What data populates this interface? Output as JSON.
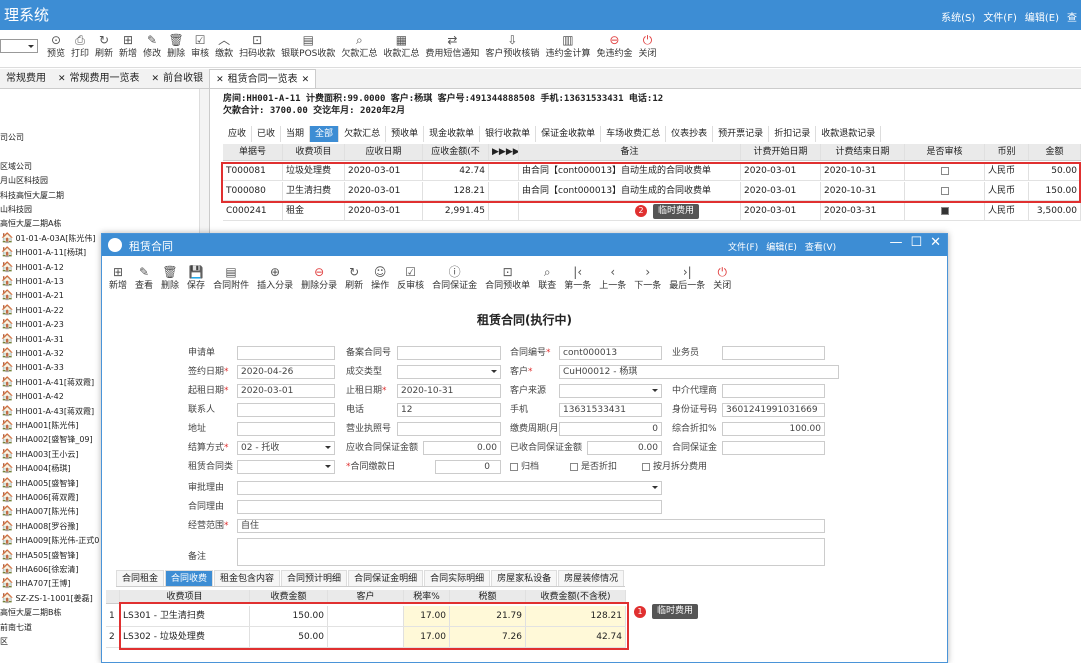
{
  "app": {
    "title": "理系统",
    "menu": [
      "系统(S)",
      "文件(F)",
      "编辑(E)",
      "查"
    ]
  },
  "toolbar": {
    "items": [
      {
        "icon": "preview-icon",
        "glyph": "⊙",
        "label": "预览"
      },
      {
        "icon": "print-icon",
        "glyph": "⎙",
        "label": "打印"
      },
      {
        "icon": "refresh-icon",
        "glyph": "↻",
        "label": "刷新"
      },
      {
        "icon": "add-icon",
        "glyph": "⊞",
        "label": "新增"
      },
      {
        "icon": "edit-icon",
        "glyph": "✎",
        "label": "修改"
      },
      {
        "icon": "delete-icon",
        "glyph": "🗑",
        "label": "删除"
      },
      {
        "icon": "audit-icon",
        "glyph": "☑",
        "label": "审核"
      },
      {
        "icon": "pay-icon",
        "glyph": "︿",
        "label": "缴款"
      },
      {
        "icon": "scan-pay-icon",
        "glyph": "⊡",
        "label": "扫码收款"
      },
      {
        "icon": "pos-icon",
        "glyph": "▤",
        "label": "银联POS收款"
      },
      {
        "icon": "arrears-icon",
        "glyph": "⌕",
        "label": "欠款汇总"
      },
      {
        "icon": "receipt-summary-icon",
        "glyph": "▦",
        "label": "收款汇总"
      },
      {
        "icon": "sms-icon",
        "glyph": "⇄",
        "label": "费用短信通知"
      },
      {
        "icon": "prepay-icon",
        "glyph": "⇩",
        "label": "客户预收核销"
      },
      {
        "icon": "penalty-icon",
        "glyph": "▥",
        "label": "违约金计算"
      },
      {
        "icon": "waive-icon",
        "glyph": "⊖",
        "label": "免违约金"
      },
      {
        "icon": "close-icon",
        "glyph": "⏻",
        "label": "关闭"
      }
    ]
  },
  "tabs": [
    {
      "label": "常规费用"
    },
    {
      "label": "常规费用一览表"
    },
    {
      "label": "前台收银"
    },
    {
      "label": "租赁合同一览表"
    }
  ],
  "tree": {
    "items": [
      "司公司",
      "",
      "区域公司",
      "月山区科技园",
      "科技高恒大厦二期",
      "山科技园",
      "高恒大厦二期A栋",
      "01-01-A-03A[陈光伟]",
      "HH001-A-11[杨琪]",
      "HH001-A-12",
      "HH001-A-13",
      "HH001-A-21",
      "HH001-A-22",
      "HH001-A-23",
      "HH001-A-31",
      "HH001-A-32",
      "HH001-A-33",
      "HH001-A-41[蒋双霞]",
      "HH001-A-42",
      "HH001-A-43[蒋双霞]",
      "HHA001[陈光伟]",
      "HHA002[盛智锋_09]",
      "HHA003[王小云]",
      "HHA004[杨琪]",
      "HHA005[盛智锋]",
      "HHA006[蒋双霞]",
      "HHA007[陈光伟]",
      "HHA008[罗谷豫]",
      "HHA009[陈光伟-正式0",
      "HHA505[盛智锋]",
      "HHA606[徐宏清]",
      "HHA707[王博]",
      "SZ-ZS-1-1001[姜磊]",
      "高恒大厦二期B栋",
      "前南七道",
      "区"
    ]
  },
  "info": {
    "line1": "房间:HH001-A-11  计费面积:99.0000 客户:杨琪 客户号:491344888508 手机:13631533431 电话:12",
    "line2": "欠款合计: 3700.00  交讫年月: 2020年2月"
  },
  "subtabs": [
    "应收",
    "已收",
    "当期",
    "全部",
    "欠款汇总",
    "预收单",
    "现金收款单",
    "银行收款单",
    "保证金收款单",
    "车场收费汇总",
    "仪表抄表",
    "预开票记录",
    "折扣记录",
    "收款退款记录"
  ],
  "grid": {
    "headers": [
      "单据号",
      "收费项目",
      "应收日期",
      "应收金额(不",
      "▶▶▶▶",
      "备注",
      "计费开始日期",
      "计费结束日期",
      "是否审核",
      "币别",
      "金额"
    ],
    "rows": [
      {
        "no": "T000081",
        "item": "垃圾处理费",
        "date": "2020-03-01",
        "amount": "42.74",
        "remark": "由合同【cont000013】自动生成的合同收费单",
        "start": "2020-03-01",
        "end": "2020-10-31",
        "currency": "人民币",
        "money": "50.00"
      },
      {
        "no": "T000080",
        "item": "卫生清扫费",
        "date": "2020-03-01",
        "amount": "128.21",
        "remark": "由合同【cont000013】自动生成的合同收费单",
        "start": "2020-03-01",
        "end": "2020-10-31",
        "currency": "人民币",
        "money": "150.00"
      },
      {
        "no": "C000241",
        "item": "租金",
        "date": "2020-03-01",
        "amount": "2,991.45",
        "remark": "",
        "start": "2020-03-01",
        "end": "2020-03-31",
        "currency": "人民币",
        "money": "3,500.00"
      }
    ]
  },
  "badges": {
    "b1": "1",
    "b2": "2",
    "tip": "临时费用"
  },
  "dialog": {
    "title": "租赁合同",
    "menu": [
      "文件(F)",
      "编辑(E)",
      "查看(V)"
    ],
    "toolbar": [
      {
        "icon": "add-icon",
        "glyph": "⊞",
        "label": "新增"
      },
      {
        "icon": "view-icon",
        "glyph": "✎",
        "label": "查看"
      },
      {
        "icon": "delete-icon",
        "glyph": "🗑",
        "label": "删除"
      },
      {
        "icon": "save-icon",
        "glyph": "💾",
        "label": "保存"
      },
      {
        "icon": "attachment-icon",
        "glyph": "▤",
        "label": "合同附件"
      },
      {
        "icon": "insert-icon",
        "glyph": "⊕",
        "label": "插入分录"
      },
      {
        "icon": "remove-row-icon",
        "glyph": "⊖",
        "label": "删除分录"
      },
      {
        "icon": "refresh-icon",
        "glyph": "↻",
        "label": "刷新"
      },
      {
        "icon": "operate-icon",
        "glyph": "☺",
        "label": "操作"
      },
      {
        "icon": "unaudit-icon",
        "glyph": "☑",
        "label": "反审核"
      },
      {
        "icon": "deposit-icon",
        "glyph": "ⓘ",
        "label": "合同保证金"
      },
      {
        "icon": "prepay-icon",
        "glyph": "⊡",
        "label": "合同预收单"
      },
      {
        "icon": "lookup-icon",
        "glyph": "⌕",
        "label": "联查"
      },
      {
        "icon": "first-icon",
        "glyph": "|‹",
        "label": "第一条"
      },
      {
        "icon": "prev-icon",
        "glyph": "‹",
        "label": "上一条"
      },
      {
        "icon": "next-icon",
        "glyph": "›",
        "label": "下一条"
      },
      {
        "icon": "last-icon",
        "glyph": "›|",
        "label": "最后一条"
      },
      {
        "icon": "close-icon",
        "glyph": "⏻",
        "label": "关闭"
      }
    ],
    "form_title": "租赁合同(执行中)",
    "fields": {
      "applicant": "申请单",
      "record_no": "备案合同号",
      "contract_no": "合同编号",
      "contract_no_v": "cont000013",
      "salesman": "业务员",
      "sign_date": "签约日期",
      "sign_date_v": "2020-04-26",
      "deal_type": "成交类型",
      "customer": "客户",
      "customer_v": "CuH00012 - 杨琪",
      "start_date": "起租日期",
      "start_date_v": "2020-03-01",
      "end_date": "止租日期",
      "end_date_v": "2020-10-31",
      "source": "客户来源",
      "agent": "中介代理商",
      "contact": "联系人",
      "phone": "电话",
      "phone_v": "12",
      "mobile": "手机",
      "mobile_v": "13631533431",
      "idcard": "身份证号码",
      "idcard_v": "3601241991031669",
      "address": "地址",
      "license": "营业执照号",
      "pay_period": "缴费周期(月)",
      "pay_period_v": "0",
      "discount": "综合折扣%",
      "discount_v": "100.00",
      "settle": "结算方式",
      "settle_v": "02 - 托收",
      "deposit_due": "应收合同保证金额",
      "deposit_due_v": "0.00",
      "deposit_recv": "已收合同保证金额",
      "deposit_recv_v": "0.00",
      "deposit": "合同保证金",
      "lease_type": "租赁合同类",
      "pay_day": "合同缴款日",
      "pay_day_v": "0",
      "archive": "归档",
      "is_discount": "是否折扣",
      "split": "按月拆分费用",
      "approve": "审批理由",
      "reason": "合同理由",
      "scope": "经营范围",
      "scope_v": "自住",
      "note": "备注"
    },
    "ctabs": [
      "合同租金",
      "合同收费",
      "租金包含内容",
      "合同预计明细",
      "合同保证金明细",
      "合同实际明细",
      "房屋家私设备",
      "房屋装修情况"
    ],
    "lgrid": {
      "headers": [
        "",
        "收费项目",
        "收费金额",
        "客户",
        "税率%",
        "税额",
        "收费金额(不含税)"
      ],
      "rows": [
        {
          "n": "1",
          "item": "LS301 - 卫生清扫费",
          "amt": "150.00",
          "cust": "",
          "rate": "17.00",
          "tax": "21.79",
          "net": "128.21"
        },
        {
          "n": "2",
          "item": "LS302 - 垃圾处理费",
          "amt": "50.00",
          "cust": "",
          "rate": "17.00",
          "tax": "7.26",
          "net": "42.74"
        }
      ]
    }
  },
  "colors": {
    "accent": "#3d8dd4",
    "highlight": "#e03030"
  }
}
